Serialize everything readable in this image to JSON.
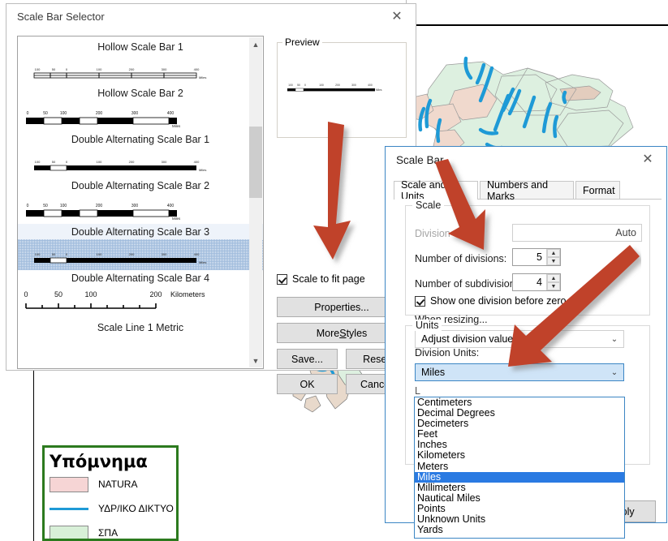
{
  "legend": {
    "title": "Υπόμνημα",
    "items": [
      {
        "label": "NATURA",
        "type": "polygon",
        "color": "#f6d5d5"
      },
      {
        "label": "ΥΔΡ/ΙΚΟ ΔΙΚΤΥΟ",
        "type": "line",
        "color": "#1e9ad6"
      },
      {
        "label": "ΣΠΑ",
        "type": "polygon",
        "color": "#d8f0d8"
      }
    ]
  },
  "selector": {
    "title": "Scale Bar Selector",
    "close_label": "✕",
    "preview_group_label": "Preview",
    "styles": [
      {
        "name": "Hollow Scale Bar 1",
        "selected": false,
        "style": "hollow",
        "ticks": [
          "100",
          "50",
          "0",
          "100",
          "200",
          "300",
          "400"
        ],
        "unit": "Miles"
      },
      {
        "name": "Hollow Scale Bar 2",
        "selected": false,
        "style": "hollow2",
        "ticks": [
          "0",
          "50",
          "100",
          "200",
          "300",
          "400"
        ],
        "unit": "Miles"
      },
      {
        "name": "Double Alternating Scale Bar 1",
        "selected": false,
        "style": "alt",
        "ticks": [
          "100",
          "50",
          "0",
          "100",
          "200",
          "300",
          "400"
        ],
        "unit": "Miles"
      },
      {
        "name": "Double Alternating Scale Bar 2",
        "selected": false,
        "style": "alt2",
        "ticks": [
          "0",
          "50",
          "100",
          "200",
          "300",
          "400"
        ],
        "unit": "Miles"
      },
      {
        "name": "Double Alternating Scale Bar 3",
        "selected": true,
        "style": "alt3",
        "ticks": [
          "100",
          "50",
          "0",
          "100",
          "200",
          "300",
          "400"
        ],
        "unit": "Miles"
      },
      {
        "name": "Double Alternating Scale Bar 4",
        "selected": false,
        "style": "line",
        "ticks": [
          "0",
          "50",
          "100",
          "200"
        ],
        "unit": "Kilometers"
      },
      {
        "name": "Scale Line 1 Metric",
        "selected": false,
        "style": "none",
        "ticks": [],
        "unit": ""
      }
    ],
    "scale_to_fit_label": "Scale to fit page",
    "scale_to_fit_checked": true,
    "buttons": {
      "properties": "Properties...",
      "more_styles_pre": "More ",
      "more_styles_key": "S",
      "more_styles_post": "tyles",
      "save": "Save...",
      "reset": "Reset",
      "ok": "OK",
      "cancel": "Cancel"
    }
  },
  "scalebar": {
    "title": "Scale Bar",
    "close_label": "✕",
    "tabs": [
      {
        "label": "Scale and Units",
        "active": true
      },
      {
        "label": "Numbers and Marks",
        "active": false
      },
      {
        "label": "Format",
        "active": false
      }
    ],
    "scale_group": {
      "label": "Scale",
      "division_value_label": "Division value:",
      "division_value": "Auto",
      "divisions_label": "Number of divisions:",
      "divisions_value": "5",
      "subdivisions_label": "Number of subdivisions:",
      "subdivisions_value": "4",
      "show_one_division_label": "Show one division before zero",
      "show_one_division_checked": true,
      "when_resizing_label": "When resizing...",
      "when_resizing_value": "Adjust division value"
    },
    "units_group": {
      "label": "Units",
      "division_units_label": "Division Units:",
      "division_units_value": "Miles",
      "options": [
        "Centimeters",
        "Decimal Degrees",
        "Decimeters",
        "Feet",
        "Inches",
        "Kilometers",
        "Meters",
        "Miles",
        "Millimeters",
        "Nautical Miles",
        "Points",
        "Unknown Units",
        "Yards"
      ],
      "selected_option": "Miles"
    },
    "apply_label": "Apply"
  },
  "annotations": {
    "arrow_color": "#c0422c",
    "arrow_count": 3
  },
  "map": {
    "land_color": "#ddf0e0",
    "natura_color": "#f0d9cd",
    "river_color": "#1e9ad6",
    "border_color": "#9a9a9a"
  }
}
